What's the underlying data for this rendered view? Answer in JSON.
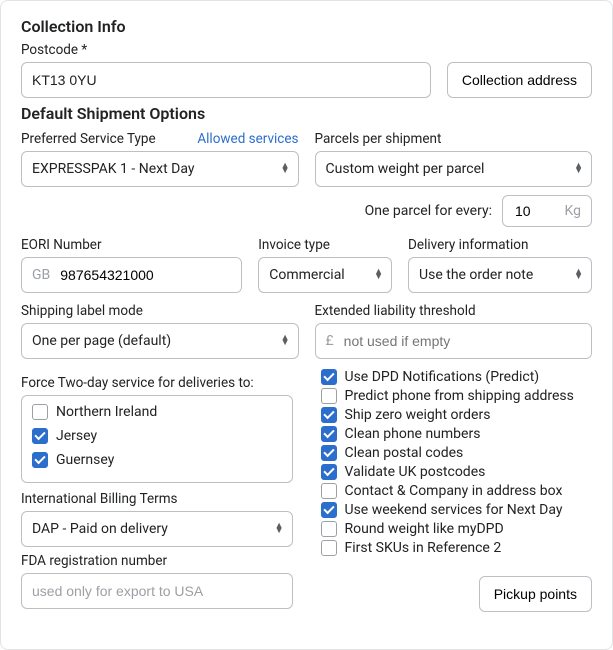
{
  "titles": {
    "collection": "Collection Info",
    "defaults": "Default Shipment Options"
  },
  "postcode": {
    "label": "Postcode *",
    "value": "KT13 0YU"
  },
  "collectionAddressBtn": "Collection address",
  "preferredService": {
    "label": "Preferred Service Type",
    "link": "Allowed services",
    "value": "EXPRESSPAK 1 - Next Day"
  },
  "parcelsPerShipment": {
    "label": "Parcels per shipment",
    "value": "Custom weight per parcel",
    "oneParcelLabel": "One parcel for every:",
    "oneParcelValue": "10",
    "oneParcelUnit": "Kg"
  },
  "eori": {
    "label": "EORI Number",
    "prefix": "GB",
    "value": "987654321000"
  },
  "invoiceType": {
    "label": "Invoice type",
    "value": "Commercial"
  },
  "deliveryInfo": {
    "label": "Delivery information",
    "value": "Use the order note"
  },
  "labelMode": {
    "label": "Shipping label mode",
    "value": "One per page (default)"
  },
  "extendedLiability": {
    "label": "Extended liability threshold",
    "prefix": "£",
    "placeholder": "not used if empty"
  },
  "forceTwoDay": {
    "label": "Force Two-day service for deliveries to:",
    "items": [
      {
        "label": "Northern Ireland",
        "checked": false
      },
      {
        "label": "Jersey",
        "checked": true
      },
      {
        "label": "Guernsey",
        "checked": true
      }
    ]
  },
  "billingTerms": {
    "label": "International Billing Terms",
    "value": "DAP - Paid on delivery"
  },
  "fda": {
    "label": "FDA registration number",
    "placeholder": "used only for export to USA"
  },
  "options": [
    {
      "label": "Use DPD Notifications (Predict)",
      "checked": true
    },
    {
      "label": "Predict phone from shipping address",
      "checked": false
    },
    {
      "label": "Ship zero weight orders",
      "checked": true
    },
    {
      "label": "Clean phone numbers",
      "checked": true
    },
    {
      "label": "Clean postal codes",
      "checked": true
    },
    {
      "label": "Validate UK postcodes",
      "checked": true
    },
    {
      "label": "Contact & Company in address box",
      "checked": false
    },
    {
      "label": "Use weekend services for Next Day",
      "checked": true
    },
    {
      "label": "Round weight like myDPD",
      "checked": false
    },
    {
      "label": "First SKUs in Reference 2",
      "checked": false
    }
  ],
  "pickupBtn": "Pickup points"
}
